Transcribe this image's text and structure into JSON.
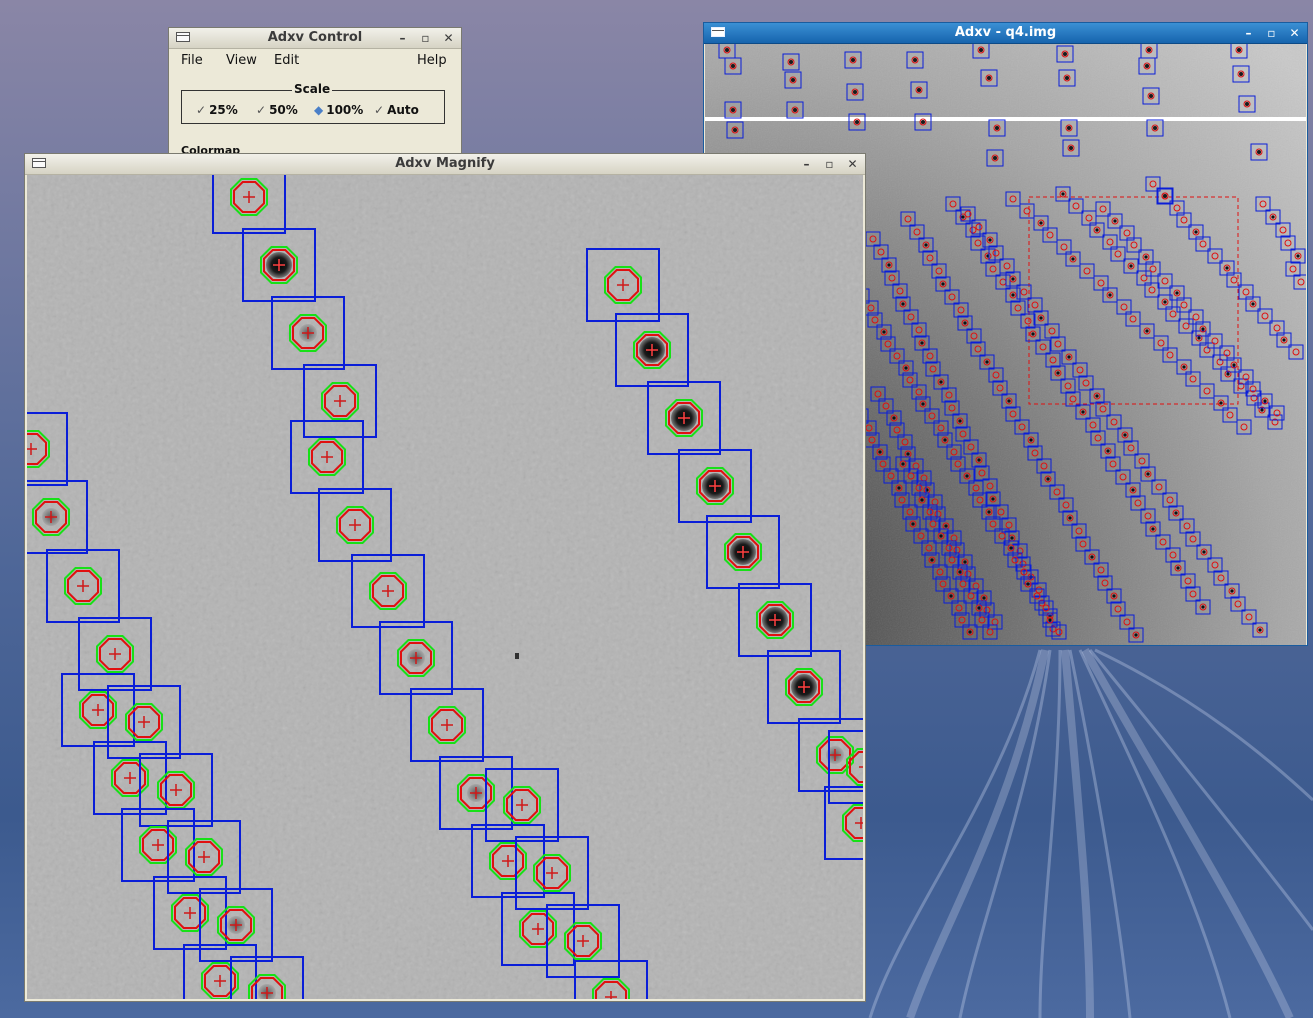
{
  "control": {
    "title": "Adxv Control",
    "menu": {
      "file": "File",
      "view": "View",
      "edit": "Edit",
      "help": "Help"
    },
    "scale": {
      "legend": "Scale",
      "options": [
        {
          "label": "25%",
          "selected": false
        },
        {
          "label": "50%",
          "selected": false
        },
        {
          "label": "100%",
          "selected": true
        },
        {
          "label": "Auto",
          "selected": false
        }
      ]
    },
    "colormap_legend": "Colormap"
  },
  "magnify": {
    "title": "Adxv Magnify"
  },
  "image": {
    "title": "Adxv - q4.img"
  },
  "colors": {
    "box": "#0a1ed8",
    "contour_outer": "#17e017",
    "contour_inner": "#e01010",
    "selection": "#e01010",
    "title_active": "#1a6bb3"
  },
  "icons": {
    "menu": "window-menu-icon",
    "minimize": "minimize-icon",
    "maximize": "maximize-icon",
    "close": "close-icon"
  }
}
